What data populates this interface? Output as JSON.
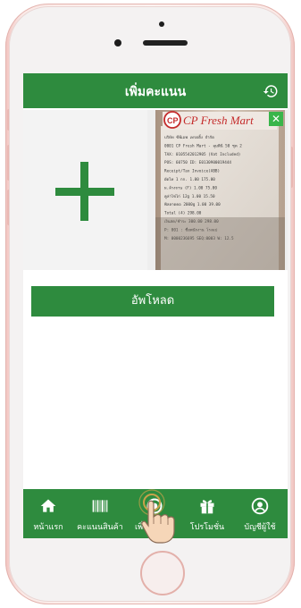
{
  "header": {
    "title": "เพิ่มคะแนน",
    "history_icon": "history-icon"
  },
  "receipt": {
    "brand": "CP Fresh Mart",
    "close_icon": "close-icon",
    "lines": [
      "บริษัท ซีพีเอฟ เทรดดิ้ง จำกัด",
      "0001  CP Fresh Mart - ลุมพินี 50 ชุด 2",
      "TAX: 0105542012905 (Vat Included)",
      "POS: 60750          ID: E0130900019444",
      "Receipt/Tax Invoice(ABB)",
      "ผัดไท 1 กก.          1.00     175.00",
      "ผ.ล้างจาน (F)        1.00      75.00",
      "คูล่าไข่ไก่ 12g        1.00      15.50",
      "พิลลาดคอ 2000g       1.00      39.00",
      "Total                 (4)     298.00",
      "เงินสด/ชำระ           300.00   298.00",
      "P: 001   : ชื่อพนักงาน โรงแบ่",
      "M: 0000236695        SEQ:0003 W: 12.5"
    ]
  },
  "upload_button": {
    "label": "อัพโหลด"
  },
  "bottom_nav": [
    {
      "icon": "home-icon",
      "label": "หน้าแรก"
    },
    {
      "icon": "barcode-icon",
      "label": "คะแนนสินค้า"
    },
    {
      "icon": "add-points-icon",
      "label": "เพิ่มคะแนน"
    },
    {
      "icon": "gift-icon",
      "label": "โปรโมชั่น"
    },
    {
      "icon": "user-account-icon",
      "label": "บัญชีผู้ใช้"
    }
  ],
  "colors": {
    "primary": "#2e8b3e",
    "background": "#ffffff",
    "phone_shell": "#f7dcd8"
  }
}
